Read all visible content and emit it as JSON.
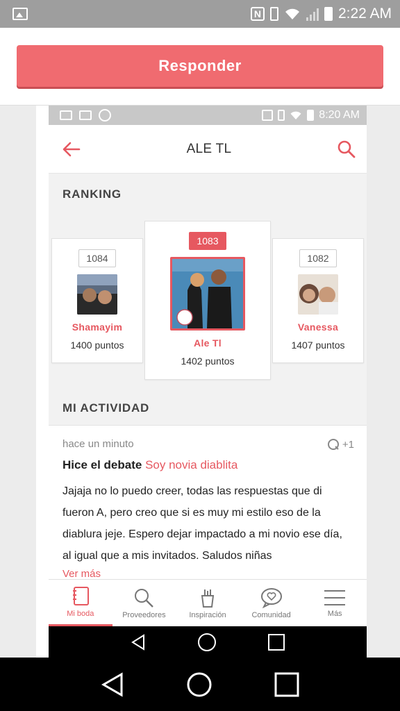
{
  "status_bar": {
    "time": "2:22 AM"
  },
  "top": {
    "reply_label": "Responder"
  },
  "inner": {
    "status_time": "8:20 AM",
    "title": "ALE TL",
    "ranking_label": "RANKING",
    "activity_label": "MI ACTIVIDAD",
    "ranking": [
      {
        "pos": "1084",
        "name": "Shamayim",
        "points": "1400 puntos"
      },
      {
        "pos": "1083",
        "name": "Ale Tl",
        "points": "1402 puntos"
      },
      {
        "pos": "1082",
        "name": "Vanessa",
        "points": "1407 puntos"
      }
    ],
    "activity": {
      "time": "hace un minuto",
      "likes": "+1",
      "title_prefix": "Hice el debate",
      "title_link": "Soy novia diablita",
      "body": "Jajaja no lo puedo creer, todas las respuestas que di fueron A, pero creo que si es muy mi estilo eso de la diablura jeje. Espero dejar impactado a mi novio ese día, al igual que a mis invitados. Saludos niñas",
      "more": "Ver más"
    },
    "tabs": [
      {
        "label": "Mi boda",
        "icon": "notebook-icon",
        "active": true
      },
      {
        "label": "Proveedores",
        "icon": "search-icon"
      },
      {
        "label": "Inspiración",
        "icon": "inspiration-icon"
      },
      {
        "label": "Comunidad",
        "icon": "chat-heart-icon"
      },
      {
        "label": "Más",
        "icon": "menu-icon"
      }
    ]
  },
  "colors": {
    "accent": "#e65860",
    "button": "#f06b70"
  }
}
